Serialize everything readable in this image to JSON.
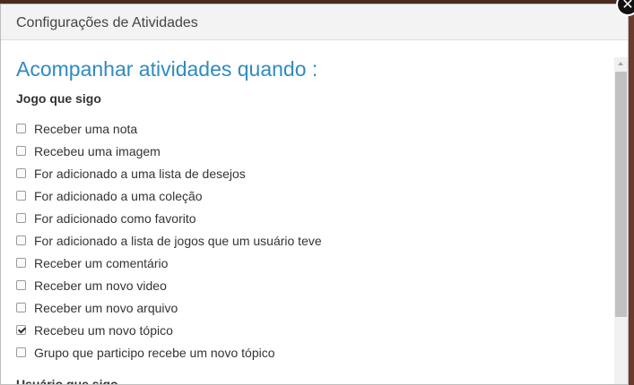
{
  "dialog": {
    "title": "Configurações de Atividades",
    "close_icon": "close-icon",
    "close_glyph": "✕"
  },
  "main": {
    "heading": "Acompanhar atividades quando :",
    "section1_label": "Jogo que sigo",
    "options": [
      {
        "label": "Receber uma nota",
        "checked": false
      },
      {
        "label": "Recebeu uma imagem",
        "checked": false
      },
      {
        "label": "For adicionado a uma lista de desejos",
        "checked": false
      },
      {
        "label": "For adicionado a uma coleção",
        "checked": false
      },
      {
        "label": "For adicionado como favorito",
        "checked": false
      },
      {
        "label": "For adicionado a lista de jogos que um usuário teve",
        "checked": false
      },
      {
        "label": "Receber um comentário",
        "checked": false
      },
      {
        "label": "Receber um novo video",
        "checked": false
      },
      {
        "label": "Receber um novo arquivo",
        "checked": false
      },
      {
        "label": "Recebeu um novo tópico",
        "checked": true
      },
      {
        "label": "Grupo que participo recebe um novo tópico",
        "checked": false
      }
    ],
    "section2_label": "Usuário que sigo"
  },
  "colors": {
    "heading": "#2f8bc0",
    "background": "#6b3a2c"
  }
}
